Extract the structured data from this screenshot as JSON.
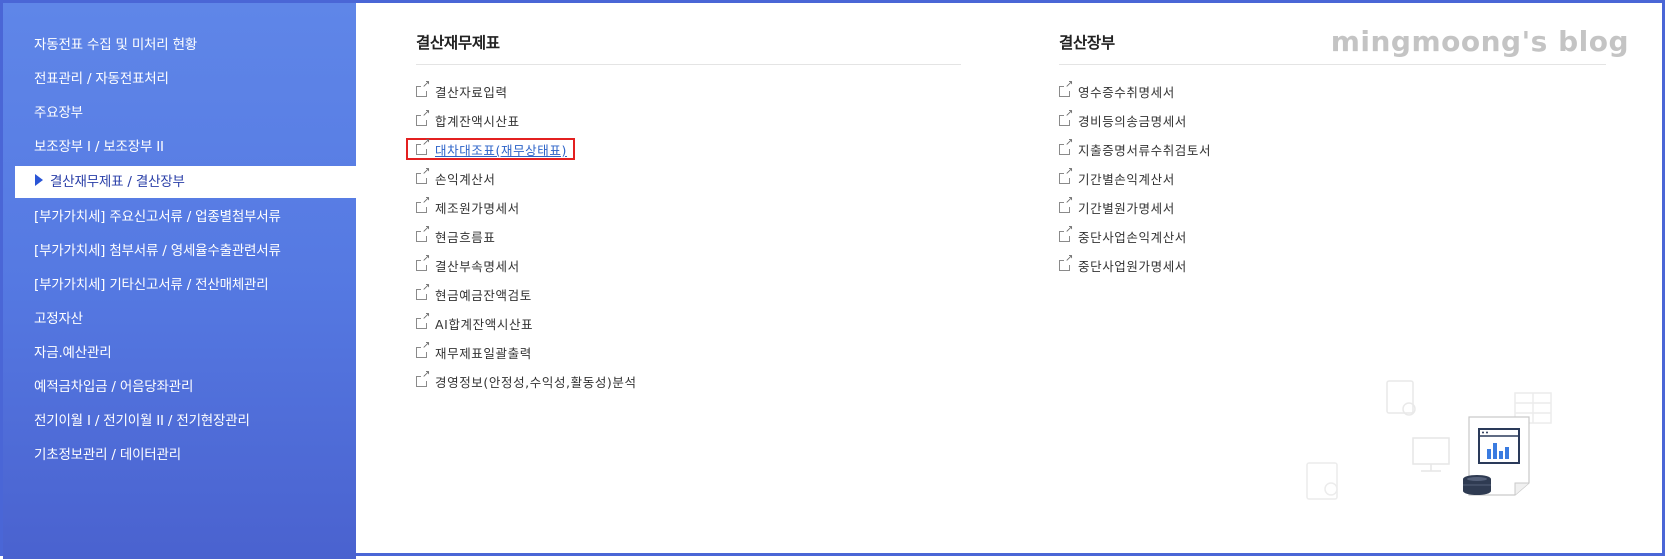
{
  "sidebar": {
    "items": [
      {
        "label": "자동전표 수집 및 미처리 현황"
      },
      {
        "label": "전표관리 / 자동전표처리"
      },
      {
        "label": "주요장부"
      },
      {
        "label": "보조장부 I / 보조장부 II"
      },
      {
        "label": "결산재무제표 / 결산장부",
        "active": true
      },
      {
        "label": "[부가가치세] 주요신고서류 / 업종별첨부서류"
      },
      {
        "label": "[부가가치세] 첨부서류 / 영세율수출관련서류"
      },
      {
        "label": "[부가가치세] 기타신고서류 / 전산매체관리"
      },
      {
        "label": "고정자산"
      },
      {
        "label": "자금.예산관리"
      },
      {
        "label": "예적금차입금 / 어음당좌관리"
      },
      {
        "label": "전기이월 Ⅰ / 전기이월 II / 전기현장관리"
      },
      {
        "label": "기초정보관리 / 데이터관리"
      }
    ]
  },
  "watermark": "mingmoong's blog",
  "sections": [
    {
      "title": "결산재무제표",
      "links": [
        {
          "label": "결산자료입력"
        },
        {
          "label": "합계잔액시산표"
        },
        {
          "label": "대차대조표(재무상태표)",
          "highlighted": true
        },
        {
          "label": "손익계산서"
        },
        {
          "label": "제조원가명세서"
        },
        {
          "label": "현금흐름표"
        },
        {
          "label": "결산부속명세서"
        },
        {
          "label": "현금예금잔액검토"
        },
        {
          "label": "AI합계잔액시산표"
        },
        {
          "label": "재무제표일괄출력"
        },
        {
          "label": "경영정보(안정성,수익성,활동성)분석"
        }
      ]
    },
    {
      "title": "결산장부",
      "links": [
        {
          "label": "영수증수취명세서"
        },
        {
          "label": "경비등의송금명세서"
        },
        {
          "label": "지출증명서류수취검토서"
        },
        {
          "label": "기간별손익계산서"
        },
        {
          "label": "기간별원가명세서"
        },
        {
          "label": "중단사업손익계산서"
        },
        {
          "label": "중단사업원가명세서"
        }
      ]
    }
  ],
  "colors": {
    "sidebar_top": "#5f86e8",
    "sidebar_bottom": "#4a62cf",
    "frame_border": "#4a66d6",
    "highlight_box": "#e32020",
    "link_active": "#2e64c9"
  },
  "icons": [
    "external-link-icon",
    "arrow-right-icon",
    "report-chart-icon",
    "coins-icon",
    "monitor-icon",
    "document-settings-icon",
    "table-icon",
    "clipboard-icon"
  ]
}
